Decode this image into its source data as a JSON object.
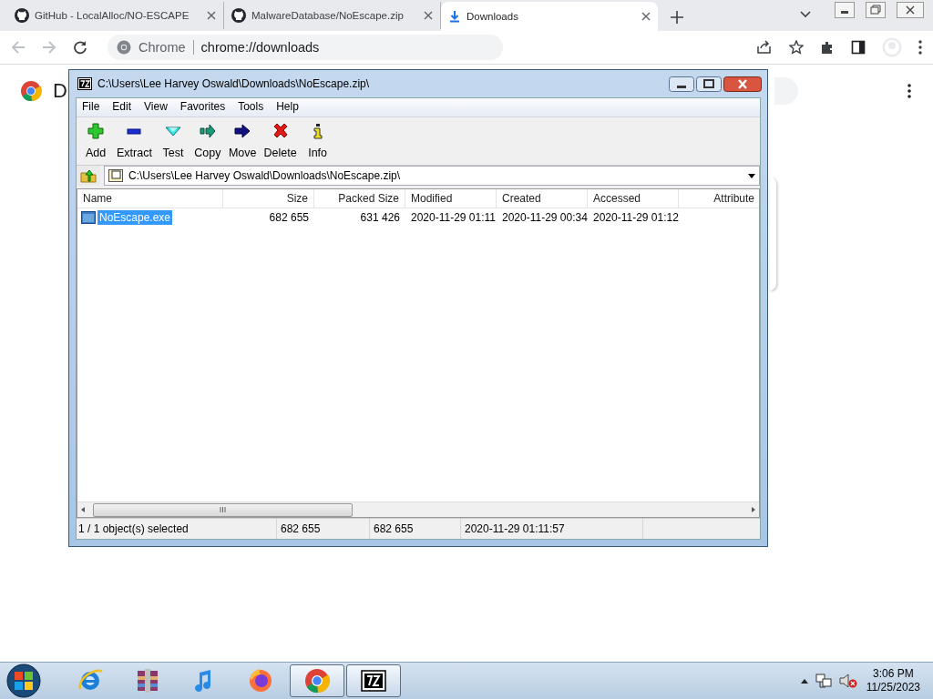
{
  "browser": {
    "tabs": [
      {
        "title": "GitHub - LocalAlloc/NO-ESCAPE",
        "kind": "github",
        "selected": false
      },
      {
        "title": "MalwareDatabase/NoEscape.zip",
        "kind": "github",
        "selected": false
      },
      {
        "title": "Downloads",
        "kind": "download",
        "selected": true
      }
    ],
    "omnibox": {
      "label": "Chrome",
      "url": "chrome://downloads"
    }
  },
  "page": {
    "heading": "D"
  },
  "archive_window": {
    "title": "C:\\Users\\Lee Harvey Oswald\\Downloads\\NoEscape.zip\\",
    "menu": [
      "File",
      "Edit",
      "View",
      "Favorites",
      "Tools",
      "Help"
    ],
    "toolbar": [
      {
        "label": "Add",
        "kind": "add"
      },
      {
        "label": "Extract",
        "kind": "extract"
      },
      {
        "label": "Test",
        "kind": "test"
      },
      {
        "label": "Copy",
        "kind": "copy"
      },
      {
        "label": "Move",
        "kind": "move"
      },
      {
        "label": "Delete",
        "kind": "delete"
      },
      {
        "label": "Info",
        "kind": "info"
      }
    ],
    "address": "C:\\Users\\Lee Harvey Oswald\\Downloads\\NoEscape.zip\\",
    "columns": [
      "Name",
      "Size",
      "Packed Size",
      "Modified",
      "Created",
      "Accessed",
      "Attribute"
    ],
    "rows": [
      {
        "cells": [
          "NoEscape.exe",
          "682 655",
          "631 426",
          "2020-11-29 01:11",
          "2020-11-29 00:34",
          "2020-11-29 01:12"
        ],
        "selected": true
      }
    ],
    "status": [
      "1 / 1 object(s) selected",
      "682 655",
      "682 655",
      "2020-11-29 01:11:57"
    ]
  },
  "taskbar": {
    "apps": [
      {
        "kind": "ie",
        "open": false
      },
      {
        "kind": "archiver",
        "open": false
      },
      {
        "kind": "music",
        "open": false
      },
      {
        "kind": "firefox",
        "open": false
      },
      {
        "kind": "chrome",
        "open": true
      },
      {
        "kind": "sevenzip",
        "open": true
      }
    ],
    "time": "3:06 PM",
    "date": "11/25/2023"
  }
}
